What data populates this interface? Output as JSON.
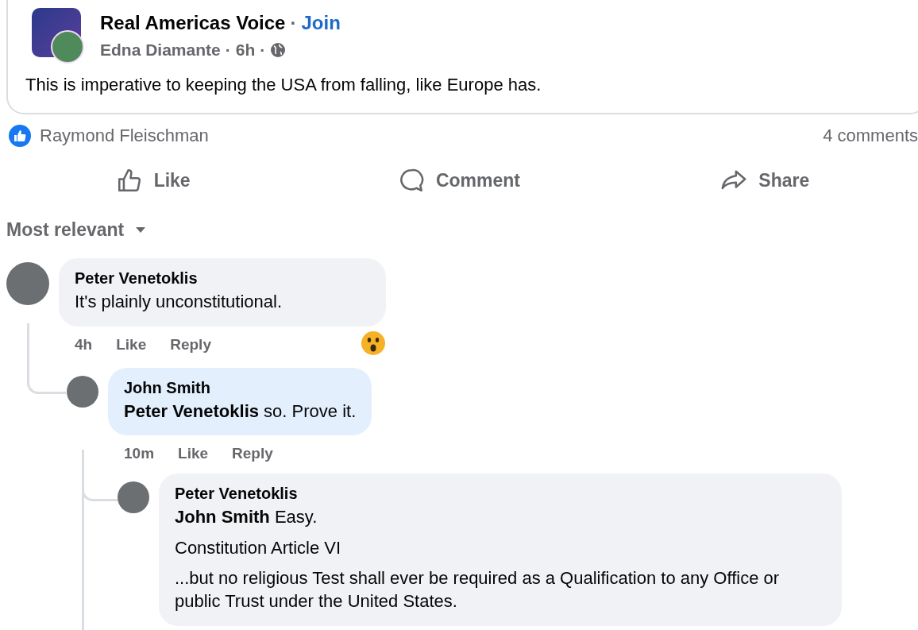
{
  "post": {
    "group": "Real Americas Voice",
    "join": "Join",
    "separator": "·",
    "author": "Edna Diamante",
    "time": "6h",
    "text": "This is imperative to keeping the USA from falling, like Europe has."
  },
  "reactions": {
    "names": "Raymond Fleischman",
    "comments": "4 comments"
  },
  "actions": [
    {
      "kind": "like",
      "label": "Like"
    },
    {
      "kind": "comment",
      "label": "Comment"
    },
    {
      "kind": "share",
      "label": "Share"
    }
  ],
  "sort": {
    "label": "Most relevant"
  },
  "comments": [
    {
      "author": "Peter Venetoklis",
      "highlighted": false,
      "paragraphs": [
        "It's plainly unconstitutional."
      ],
      "time": "4h",
      "like": "Like",
      "reply": "Reply",
      "has_reaction": true,
      "children": [
        {
          "author": "John Smith",
          "highlighted": true,
          "paragraphs": [
            "**Peter Venetoklis** so. Prove it."
          ],
          "time": "10m",
          "like": "Like",
          "reply": "Reply",
          "children": [
            {
              "author": "Peter Venetoklis",
              "highlighted": false,
              "paragraphs": [
                "**John Smith** Easy.",
                "Constitution Article VI",
                "...but no religious Test shall ever be required as a Qualification to any Office or public Trust under the United States."
              ]
            }
          ]
        }
      ]
    }
  ]
}
